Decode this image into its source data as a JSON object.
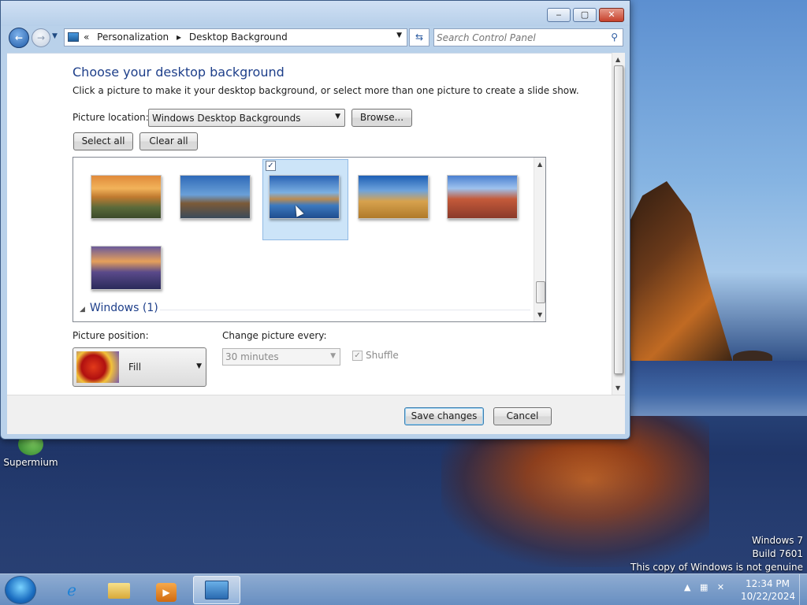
{
  "desktop": {
    "icon_label": "Supermium",
    "watermark": [
      "Windows 7",
      "Build 7601",
      "This copy of Windows is not genuine"
    ]
  },
  "window": {
    "caption_buttons": {
      "minimize": "‒",
      "maximize": "▢",
      "close": "✕"
    },
    "breadcrumb": [
      "Personalization",
      "Desktop Background"
    ],
    "search_placeholder": "Search Control Panel",
    "heading": "Choose your desktop background",
    "subtitle": "Click a picture to make it your desktop background, or select more than one picture to create a slide show.",
    "picture_location_label": "Picture location:",
    "picture_location_value": "Windows Desktop Backgrounds",
    "browse_label": "Browse...",
    "select_all_label": "Select all",
    "clear_all_label": "Clear all",
    "gallery": {
      "selected_index": 3,
      "group_label": "Windows (1)"
    },
    "picture_position_label": "Picture position:",
    "picture_position_value": "Fill",
    "change_every_label": "Change picture every:",
    "change_every_value": "30 minutes",
    "shuffle_label": "Shuffle",
    "save_label": "Save changes",
    "cancel_label": "Cancel"
  },
  "taskbar": {
    "clock_time": "12:34 PM",
    "clock_date": "10/22/2024"
  },
  "colors": {
    "accent": "#1e3f8a",
    "selection": "#cce4f8",
    "close_button": "#c6412c"
  }
}
